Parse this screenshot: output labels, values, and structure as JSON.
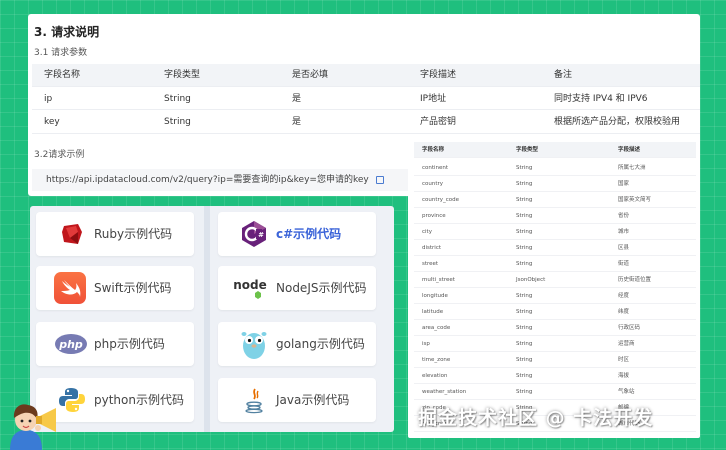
{
  "doc": {
    "section_title": "3. 请求说明",
    "params_subtitle": "3.1 请求参数",
    "params_table": {
      "headers": [
        "字段名称",
        "字段类型",
        "是否必填",
        "字段描述",
        "备注"
      ],
      "rows": [
        [
          "ip",
          "String",
          "是",
          "IP地址",
          "同时支持 IPV4 和 IPV6"
        ],
        [
          "key",
          "String",
          "是",
          "产品密钥",
          "根据所选产品分配，权限校验用"
        ]
      ]
    },
    "example_subtitle": "3.2请求示例",
    "example_url": "https://api.ipdatacloud.com/v2/query?ip=需要查询的ip&key=您申请的key"
  },
  "code_examples": {
    "left": [
      {
        "label": "Ruby示例代码",
        "icon": "ruby-icon"
      },
      {
        "label": "Swift示例代码",
        "icon": "swift-icon"
      },
      {
        "label": "php示例代码",
        "icon": "php-icon"
      },
      {
        "label": "python示例代码",
        "icon": "python-icon"
      }
    ],
    "right": [
      {
        "label": "c#示例代码",
        "icon": "csharp-icon",
        "active": true
      },
      {
        "label": "NodeJS示例代码",
        "icon": "nodejs-icon"
      },
      {
        "label": "golang示例代码",
        "icon": "golang-icon"
      },
      {
        "label": "Java示例代码",
        "icon": "java-icon"
      }
    ],
    "node_logo_text": "node",
    "php_logo_text": "php"
  },
  "fields_table": {
    "headers": [
      "字段名称",
      "字段类型",
      "字段描述"
    ],
    "rows": [
      [
        "continent",
        "String",
        "所属七大洲"
      ],
      [
        "country",
        "String",
        "国家"
      ],
      [
        "country_code",
        "String",
        "国家英文简写"
      ],
      [
        "province",
        "String",
        "省份"
      ],
      [
        "city",
        "String",
        "城市"
      ],
      [
        "district",
        "String",
        "区县"
      ],
      [
        "street",
        "String",
        "街道"
      ],
      [
        "multi_street",
        "JsonObject",
        "历史街道位置"
      ],
      [
        "longitude",
        "String",
        "经度"
      ],
      [
        "latitude",
        "String",
        "纬度"
      ],
      [
        "area_code",
        "String",
        "行政区码"
      ],
      [
        "isp",
        "String",
        "运营商"
      ],
      [
        "time_zone",
        "String",
        "时区"
      ],
      [
        "elevation",
        "String",
        "海拔"
      ],
      [
        "weather_station",
        "String",
        "气象站"
      ],
      [
        "zip_code",
        "String",
        "邮编"
      ],
      [
        "city_code",
        "String",
        "城市代码"
      ]
    ]
  },
  "watermark": "掘金技术社区 @ 卡法开发",
  "colors": {
    "background": "#1fbf7e",
    "active_link": "#3a63d8",
    "header_bg": "#f2f4f7"
  }
}
